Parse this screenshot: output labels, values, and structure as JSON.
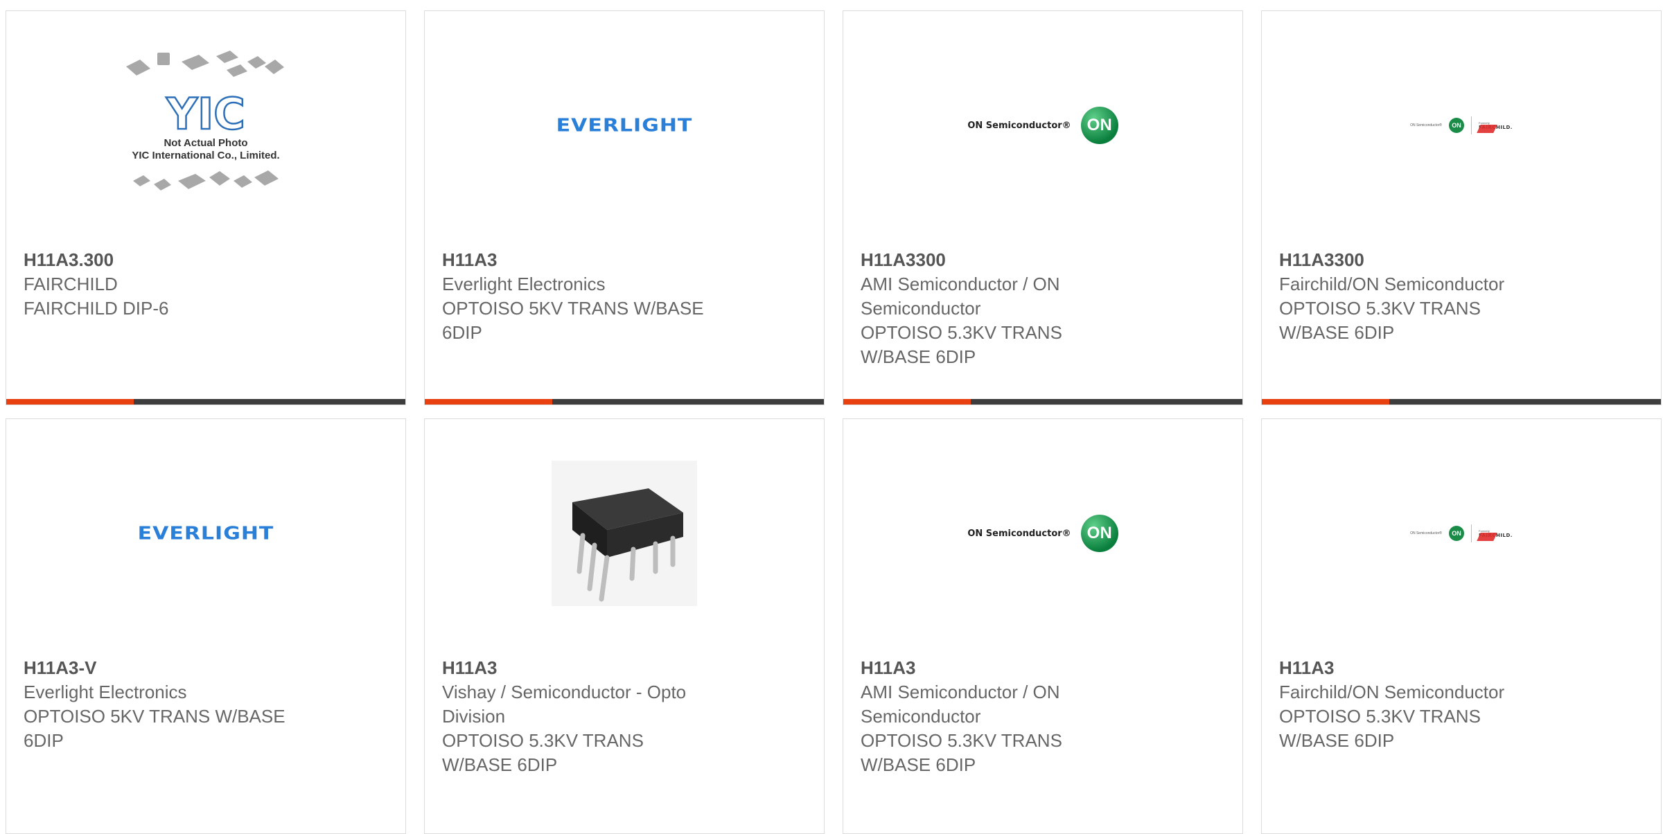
{
  "products": [
    {
      "part": "H11A3.300",
      "manufacturer": "FAIRCHILD",
      "description": "FAIRCHILD DIP-6",
      "logo": "yic-placeholder",
      "photo_note_1": "Not Actual Photo",
      "photo_note_2": "YIC International Co., Limited.",
      "logo_text": "YIC"
    },
    {
      "part": "H11A3",
      "manufacturer": "Everlight Electronics",
      "description": "OPTOISO 5KV TRANS W/BASE\n6DIP",
      "logo": "everlight-logo",
      "logo_text": "EVERLIGHT"
    },
    {
      "part": "H11A3300",
      "manufacturer": "AMI Semiconductor / ON\nSemiconductor",
      "description": "OPTOISO 5.3KV TRANS\nW/BASE 6DIP",
      "logo": "on-semiconductor-logo",
      "logo_text": "ON Semiconductor®",
      "logo_mark": "ON"
    },
    {
      "part": "H11A3300",
      "manufacturer": "Fairchild/ON Semiconductor",
      "description": "OPTOISO 5.3KV TRANS\nW/BASE 6DIP",
      "logo": "fairchild-on-logo",
      "logo_text": "ON Semiconductor®",
      "logo_mark": "ON",
      "formerly": "Formerly",
      "brand": "FAIRCHILD."
    },
    {
      "part": "H11A3-V",
      "manufacturer": "Everlight Electronics",
      "description": "OPTOISO 5KV TRANS W/BASE\n6DIP",
      "logo": "everlight-logo",
      "logo_text": "EVERLIGHT"
    },
    {
      "part": "H11A3",
      "manufacturer": "Vishay / Semiconductor - Opto\nDivision",
      "description": "OPTOISO 5.3KV TRANS\nW/BASE 6DIP",
      "logo": "dip6-chip-photo"
    },
    {
      "part": "H11A3",
      "manufacturer": "AMI Semiconductor / ON\nSemiconductor",
      "description": "OPTOISO 5.3KV TRANS\nW/BASE 6DIP",
      "logo": "on-semiconductor-logo",
      "logo_text": "ON Semiconductor®",
      "logo_mark": "ON"
    },
    {
      "part": "H11A3",
      "manufacturer": "Fairchild/ON Semiconductor",
      "description": "OPTOISO 5.3KV TRANS\nW/BASE 6DIP",
      "logo": "fairchild-on-logo",
      "logo_text": "ON Semiconductor®",
      "logo_mark": "ON",
      "formerly": "Formerly",
      "brand": "FAIRCHILD."
    }
  ],
  "colors": {
    "accent": "#e8400e",
    "bar": "#3d3d3d",
    "text": "#666666"
  }
}
